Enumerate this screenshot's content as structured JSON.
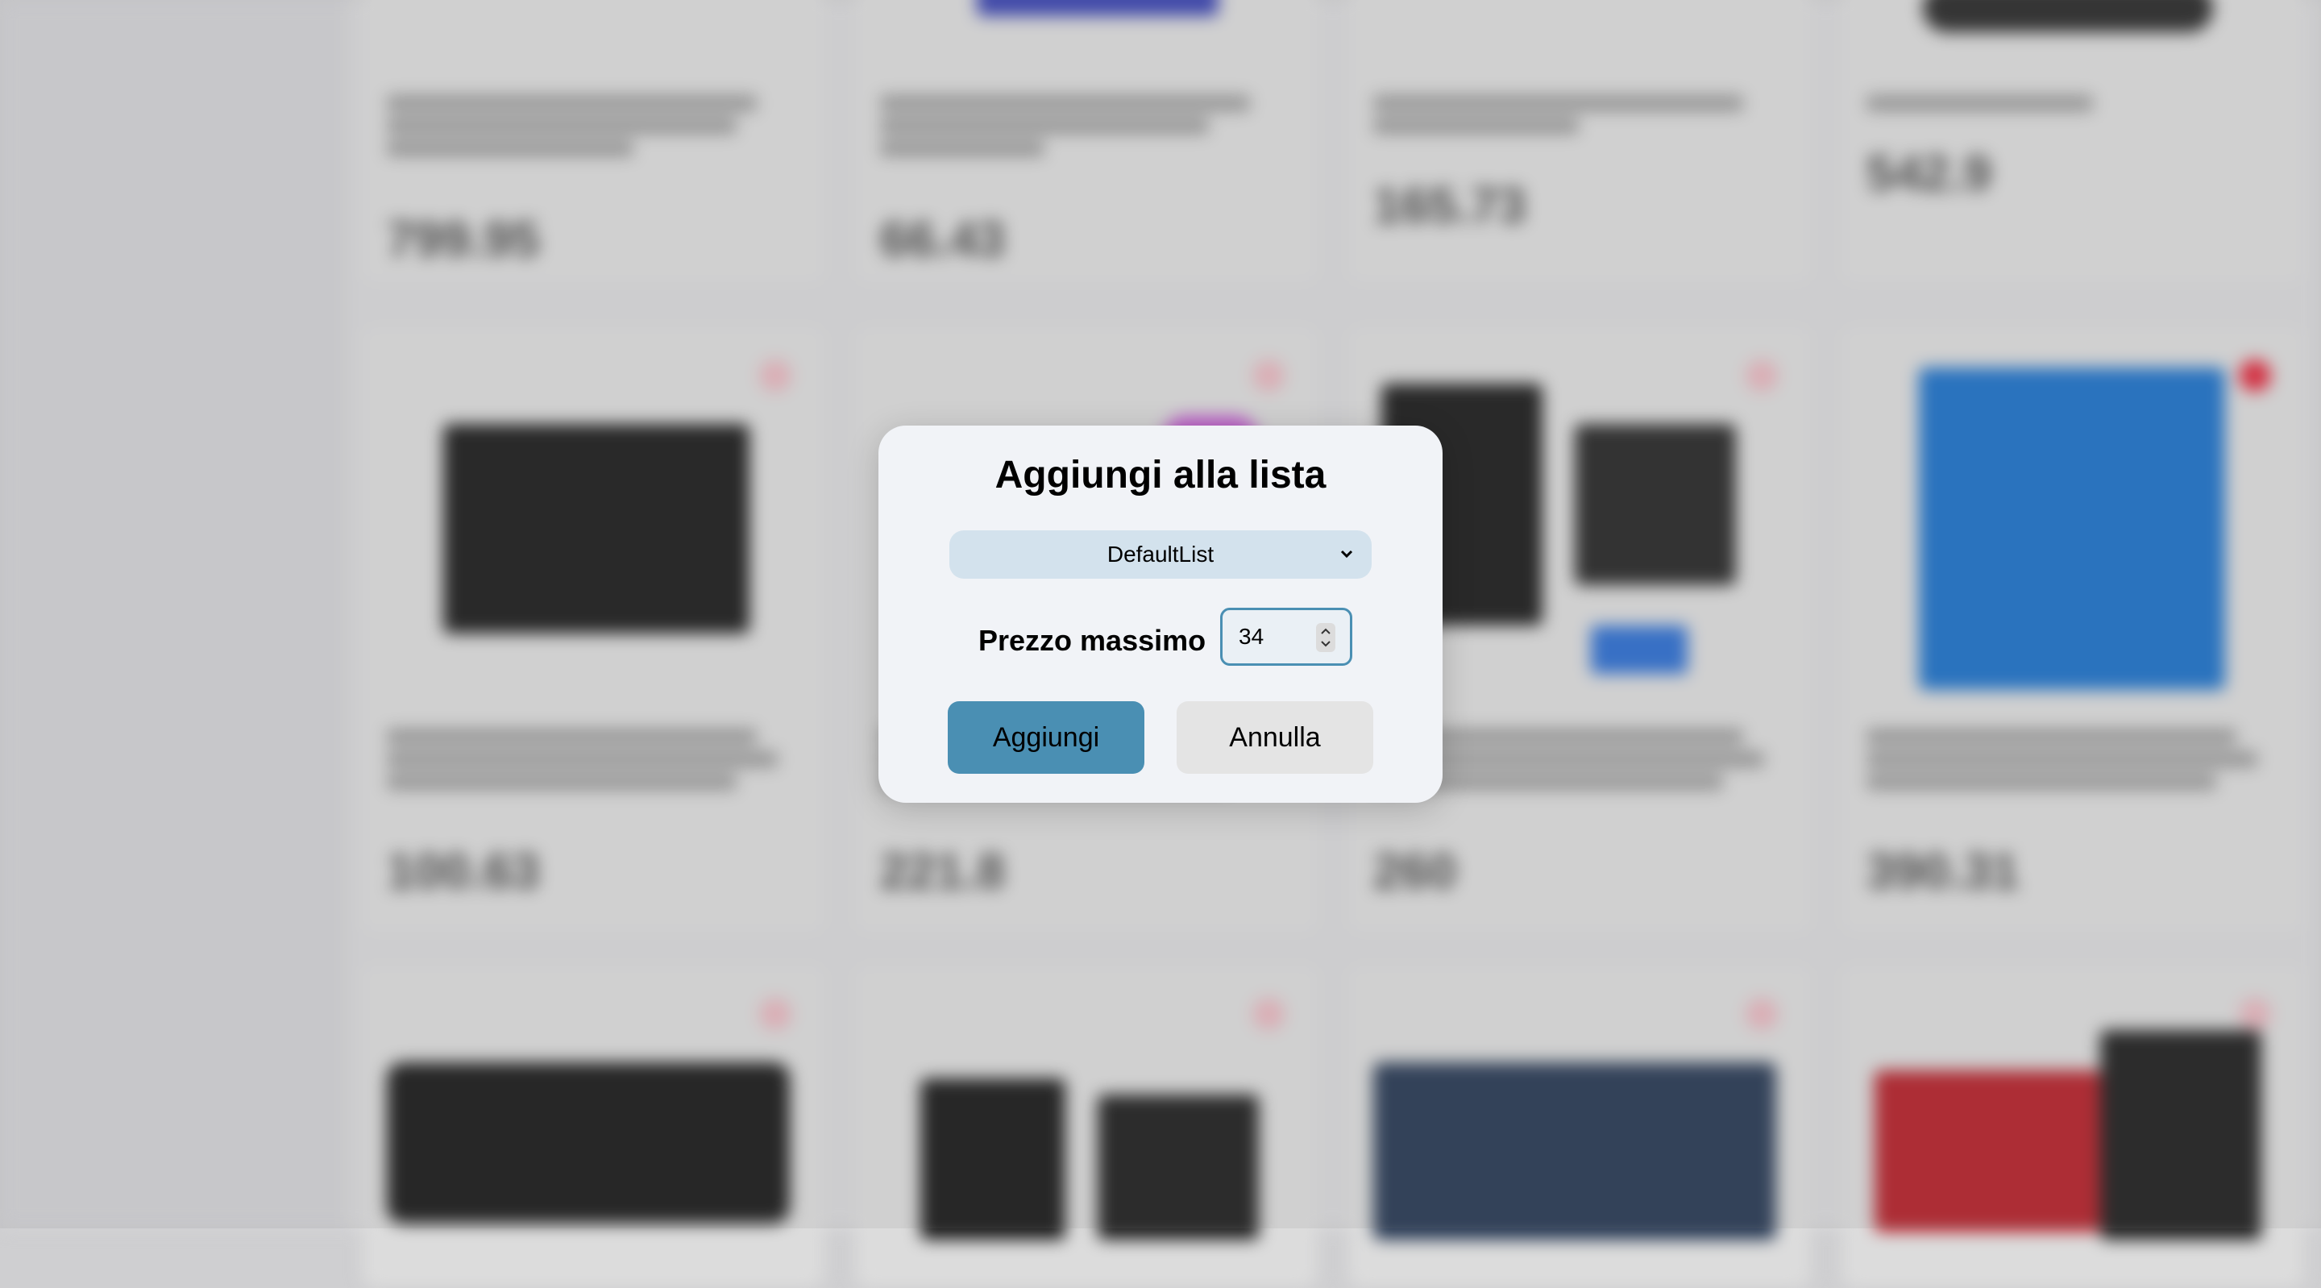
{
  "modal": {
    "title": "Aggiungi alla lista",
    "list_select": {
      "selected": "DefaultList"
    },
    "max_price_label": "Prezzo massimo",
    "max_price_value": "34",
    "add_button": "Aggiungi",
    "cancel_button": "Annulla"
  },
  "background_products": [
    {
      "price": "799.95"
    },
    {
      "price": "66.43"
    },
    {
      "price": "165.73"
    },
    {
      "price": "542.9"
    },
    {
      "price": "100.63"
    },
    {
      "price": "221.8"
    },
    {
      "price": "260"
    },
    {
      "price": "390.31"
    }
  ]
}
